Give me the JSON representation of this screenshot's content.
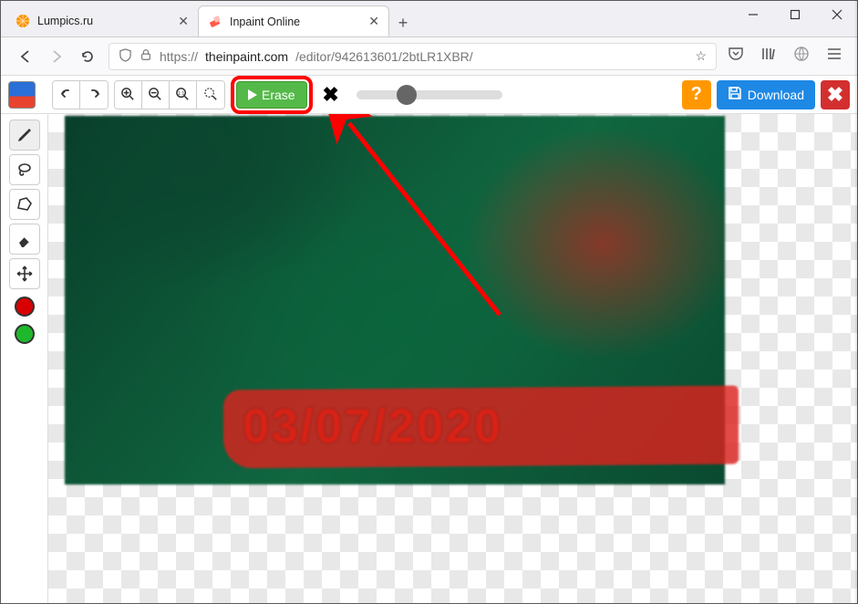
{
  "window": {
    "minimize": "─",
    "maximize": "☐",
    "close": "✕"
  },
  "tabs": {
    "t0": {
      "title": "Lumpics.ru"
    },
    "t1": {
      "title": "Inpaint Online"
    },
    "new": "+"
  },
  "addressbar": {
    "protocol": "https://",
    "domain": "theinpaint.com",
    "path": "/editor/942613601/2btLR1XBR/"
  },
  "toolbar": {
    "erase_label": "Erase",
    "help_label": "?",
    "download_label": "Download"
  },
  "side": {
    "colors": {
      "red": "#d80000",
      "green": "#1fb82c"
    }
  },
  "image": {
    "datestamp": "03/07/2020"
  }
}
